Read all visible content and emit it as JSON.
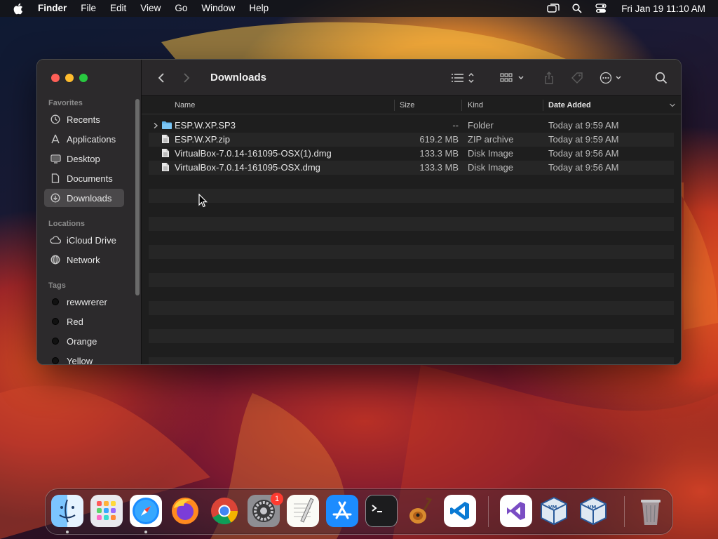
{
  "menubar": {
    "app": "Finder",
    "menus": [
      "File",
      "Edit",
      "View",
      "Go",
      "Window",
      "Help"
    ],
    "clock": "Fri Jan 19  11:10 AM",
    "icons": [
      "screen-mirroring-icon",
      "search-icon",
      "control-center-icon"
    ]
  },
  "window": {
    "title": "Downloads",
    "sidebar": {
      "favorites_header": "Favorites",
      "favorites": [
        {
          "label": "Recents",
          "icon": "clock-icon"
        },
        {
          "label": "Applications",
          "icon": "applications-icon"
        },
        {
          "label": "Desktop",
          "icon": "desktop-icon"
        },
        {
          "label": "Documents",
          "icon": "document-icon"
        },
        {
          "label": "Downloads",
          "icon": "download-icon",
          "active": true
        }
      ],
      "locations_header": "Locations",
      "locations": [
        {
          "label": "iCloud Drive",
          "icon": "cloud-icon"
        },
        {
          "label": "Network",
          "icon": "globe-icon"
        }
      ],
      "tags_header": "Tags",
      "tags": [
        {
          "label": "rewwrerer"
        },
        {
          "label": "Red"
        },
        {
          "label": "Orange"
        },
        {
          "label": "Yellow"
        }
      ]
    },
    "columns": {
      "name": "Name",
      "size": "Size",
      "kind": "Kind",
      "date": "Date Added"
    },
    "files": [
      {
        "name": "ESP.W.XP.SP3",
        "size": "--",
        "kind": "Folder",
        "date": "Today at 9:59 AM",
        "type": "folder"
      },
      {
        "name": "ESP.W.XP.zip",
        "size": "619.2 MB",
        "kind": "ZIP archive",
        "date": "Today at 9:59 AM",
        "type": "file"
      },
      {
        "name": "VirtualBox-7.0.14-161095-OSX(1).dmg",
        "size": "133.3 MB",
        "kind": "Disk Image",
        "date": "Today at 9:56 AM",
        "type": "file"
      },
      {
        "name": "VirtualBox-7.0.14-161095-OSX.dmg",
        "size": "133.3 MB",
        "kind": "Disk Image",
        "date": "Today at 9:56 AM",
        "type": "file"
      }
    ]
  },
  "dock": {
    "apps": [
      "Finder",
      "Launchpad",
      "Safari",
      "Firefox",
      "Chrome",
      "System Settings",
      "TextEdit",
      "App Store",
      "Terminal",
      "GarageBand",
      "Visual Studio Code",
      "Visual Studio",
      "VirtualBox",
      "VirtualBox"
    ],
    "settings_badge": "1"
  }
}
